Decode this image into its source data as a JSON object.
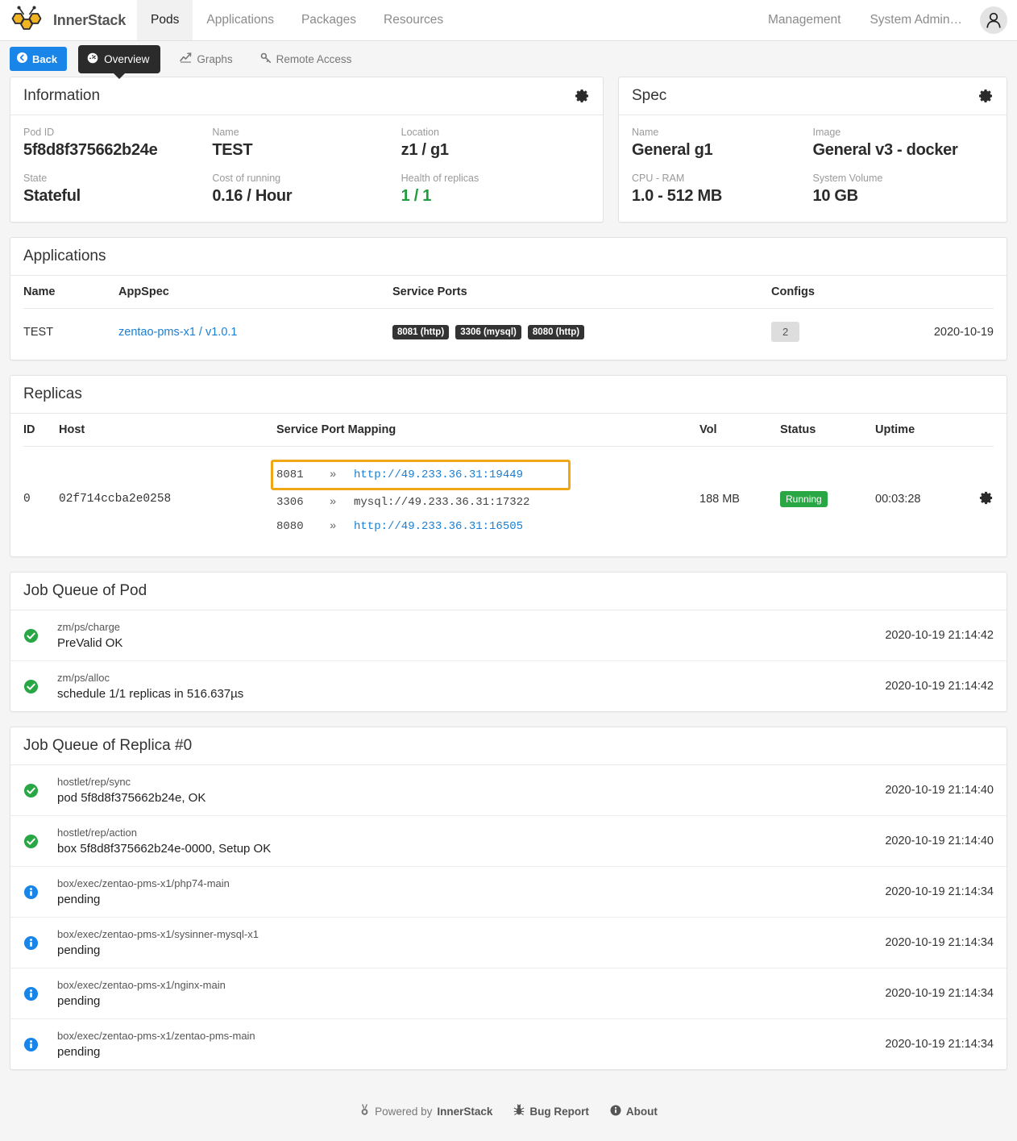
{
  "nav": {
    "brand": "InnerStack",
    "brand_logo_icon": "bee-honeycomb-logo",
    "items": [
      {
        "label": "Pods",
        "active": true
      },
      {
        "label": "Applications",
        "active": false
      },
      {
        "label": "Packages",
        "active": false
      },
      {
        "label": "Resources",
        "active": false
      }
    ],
    "right_items": [
      {
        "label": "Management"
      },
      {
        "label": "System Admin…"
      }
    ],
    "avatar_icon": "user-avatar-icon"
  },
  "toolbar": {
    "back_label": "Back",
    "back_icon": "chevron-left-circle-icon",
    "overview_label": "Overview",
    "overview_icon": "dashboard-gauge-icon",
    "graphs_label": "Graphs",
    "graphs_icon": "line-chart-icon",
    "remote_access_label": "Remote Access",
    "remote_access_icon": "key-icon"
  },
  "information": {
    "title": "Information",
    "gear_icon": "gear-icon",
    "fields": [
      {
        "label": "Pod ID",
        "value": "5f8d8f375662b24e",
        "green": false
      },
      {
        "label": "Name",
        "value": "TEST",
        "green": false
      },
      {
        "label": "Location",
        "value": "z1 / g1",
        "green": false
      },
      {
        "label": "State",
        "value": "Stateful",
        "green": false
      },
      {
        "label": "Cost of running",
        "value": "0.16 / Hour",
        "green": false
      },
      {
        "label": "Health of replicas",
        "value": "1 / 1",
        "green": true
      }
    ]
  },
  "spec": {
    "title": "Spec",
    "gear_icon": "gear-icon",
    "fields": [
      {
        "label": "Name",
        "value": "General g1"
      },
      {
        "label": "Image",
        "value": "General v3 - docker"
      },
      {
        "label": "CPU - RAM",
        "value": "1.0 - 512 MB"
      },
      {
        "label": "System Volume",
        "value": "10 GB"
      }
    ]
  },
  "applications": {
    "title": "Applications",
    "columns": [
      "Name",
      "AppSpec",
      "Service Ports",
      "Configs",
      ""
    ],
    "rows": [
      {
        "name": "TEST",
        "appspec": "zentao-pms-x1 / v1.0.1",
        "service_ports": [
          "8081 (http)",
          "3306 (mysql)",
          "8080 (http)"
        ],
        "configs": "2",
        "date": "2020-10-19"
      }
    ]
  },
  "replicas": {
    "title": "Replicas",
    "columns": [
      "ID",
      "Host",
      "Service Port Mapping",
      "Vol",
      "Status",
      "Uptime",
      ""
    ],
    "rows": [
      {
        "id": "0",
        "host": "02f714ccba2e0258",
        "port_mappings": [
          {
            "port": "8081",
            "arrow": "»",
            "target": "http://49.233.36.31:19449",
            "is_link": true,
            "highlighted": true
          },
          {
            "port": "3306",
            "arrow": "»",
            "target": "mysql://49.233.36.31:17322",
            "is_link": false,
            "highlighted": false
          },
          {
            "port": "8080",
            "arrow": "»",
            "target": "http://49.233.36.31:16505",
            "is_link": true,
            "highlighted": false
          }
        ],
        "vol": "188 MB",
        "status": "Running",
        "uptime": "00:03:28",
        "gear_icon": "gear-icon"
      }
    ]
  },
  "job_queue_pod": {
    "title": "Job Queue of Pod",
    "jobs": [
      {
        "icon": "check-circle-icon",
        "status": "ok",
        "name": "zm/ps/charge",
        "desc": "PreValid OK",
        "time": "2020-10-19 21:14:42"
      },
      {
        "icon": "check-circle-icon",
        "status": "ok",
        "name": "zm/ps/alloc",
        "desc": "schedule 1/1 replicas in 516.637µs",
        "time": "2020-10-19 21:14:42"
      }
    ]
  },
  "job_queue_replica": {
    "title": "Job Queue of Replica #0",
    "jobs": [
      {
        "icon": "check-circle-icon",
        "status": "ok",
        "name": "hostlet/rep/sync",
        "desc": "pod 5f8d8f375662b24e, OK",
        "time": "2020-10-19 21:14:40"
      },
      {
        "icon": "check-circle-icon",
        "status": "ok",
        "name": "hostlet/rep/action",
        "desc": "box 5f8d8f375662b24e-0000, Setup OK",
        "time": "2020-10-19 21:14:40"
      },
      {
        "icon": "info-circle-icon",
        "status": "info",
        "name": "box/exec/zentao-pms-x1/php74-main",
        "desc": "pending",
        "time": "2020-10-19 21:14:34"
      },
      {
        "icon": "info-circle-icon",
        "status": "info",
        "name": "box/exec/zentao-pms-x1/sysinner-mysql-x1",
        "desc": "pending",
        "time": "2020-10-19 21:14:34"
      },
      {
        "icon": "info-circle-icon",
        "status": "info",
        "name": "box/exec/zentao-pms-x1/nginx-main",
        "desc": "pending",
        "time": "2020-10-19 21:14:34"
      },
      {
        "icon": "info-circle-icon",
        "status": "info",
        "name": "box/exec/zentao-pms-x1/zentao-pms-main",
        "desc": "pending",
        "time": "2020-10-19 21:14:34"
      }
    ]
  },
  "footer": {
    "powered_prefix": "Powered by ",
    "powered_brand": "InnerStack",
    "powered_icon": "medal-icon",
    "bug_report": "Bug Report",
    "bug_icon": "bug-icon",
    "about": "About",
    "about_icon": "info-circle-icon"
  },
  "colors": {
    "accent_blue": "#1a85e8",
    "link_blue": "#1a7fd4",
    "success_green": "#2aa745",
    "highlight_orange": "#efa716",
    "dark": "#2b2b2b",
    "brand_yellow": "#f0b323"
  }
}
